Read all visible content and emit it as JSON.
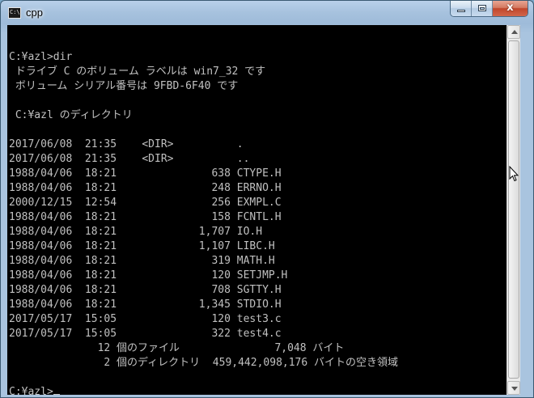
{
  "window": {
    "title": "cpp",
    "icon": "console-icon",
    "icon_text": "C:\\",
    "close_glyph": "x"
  },
  "console": {
    "lines": [
      "",
      "C:¥azl>dir",
      " ドライブ C のボリューム ラベルは win7_32 です",
      " ボリューム シリアル番号は 9FBD-6F40 です",
      "",
      " C:¥azl のディレクトリ",
      "",
      "2017/06/08  21:35    <DIR>          .",
      "2017/06/08  21:35    <DIR>          ..",
      "1988/04/06  18:21               638 CTYPE.H",
      "1988/04/06  18:21               248 ERRNO.H",
      "2000/12/15  12:54               256 EXMPL.C",
      "1988/04/06  18:21               158 FCNTL.H",
      "1988/04/06  18:21             1,707 IO.H",
      "1988/04/06  18:21             1,107 LIBC.H",
      "1988/04/06  18:21               319 MATH.H",
      "1988/04/06  18:21               120 SETJMP.H",
      "1988/04/06  18:21               708 SGTTY.H",
      "1988/04/06  18:21             1,345 STDIO.H",
      "2017/05/17  15:05               120 test3.c",
      "2017/05/17  15:05               322 test4.c",
      "              12 個のファイル               7,048 バイト",
      "               2 個のディレクトリ  459,442,098,176 バイトの空き領域",
      "",
      "C:¥azl>"
    ]
  },
  "colors": {
    "console_bg": "#000000",
    "console_fg": "#c0c0c0",
    "close_button": "#c0462c"
  }
}
